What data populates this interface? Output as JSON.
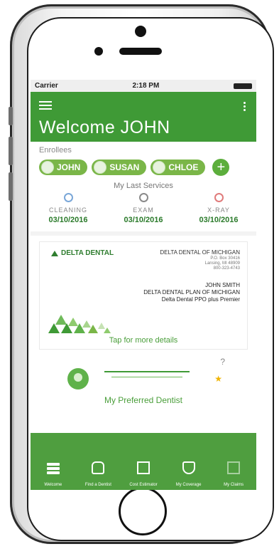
{
  "statusbar": {
    "carrier": "Carrier",
    "time": "2:18 PM"
  },
  "header": {
    "title": "Welcome JOHN"
  },
  "enrollees": {
    "label": "Enrollees",
    "members": [
      "JOHN",
      "SUSAN",
      "CHLOE"
    ],
    "add_icon": "+"
  },
  "services": {
    "title": "My Last Services",
    "items": [
      {
        "name": "CLEANING",
        "date": "03/10/2016",
        "color": "#7aa7d8"
      },
      {
        "name": "EXAM",
        "date": "03/10/2016",
        "color": "#8a8a8a"
      },
      {
        "name": "X-RAY",
        "date": "03/10/2016",
        "color": "#e07b7b"
      }
    ]
  },
  "card": {
    "logo": "DELTA DENTAL",
    "company": "DELTA DENTAL OF MICHIGAN",
    "address1": "P.O. Box 30416",
    "address2": "Lansing, MI 48909",
    "phone": "800-323-4743",
    "member_name": "JOHN SMITH",
    "plan_name": "DELTA DENTAL PLAN OF MICHIGAN",
    "plan_product": "Delta Dental PPO plus Premier",
    "tap_text": "Tap for more details"
  },
  "dentist": {
    "label": "My Preferred Dentist",
    "help": "?",
    "star": "★"
  },
  "nav": {
    "items": [
      {
        "label": "Welcome",
        "icon": "menu-icon"
      },
      {
        "label": "Find a Dentist",
        "icon": "tooth-icon"
      },
      {
        "label": "Cost Estimator",
        "icon": "calculator-icon"
      },
      {
        "label": "My Coverage",
        "icon": "shield-tooth-icon"
      },
      {
        "label": "My Claims",
        "icon": "claims-icon"
      }
    ]
  },
  "colors": {
    "brand_green": "#3f9a36",
    "nav_green": "#4f9e3f",
    "date_green": "#2a7a2a"
  }
}
